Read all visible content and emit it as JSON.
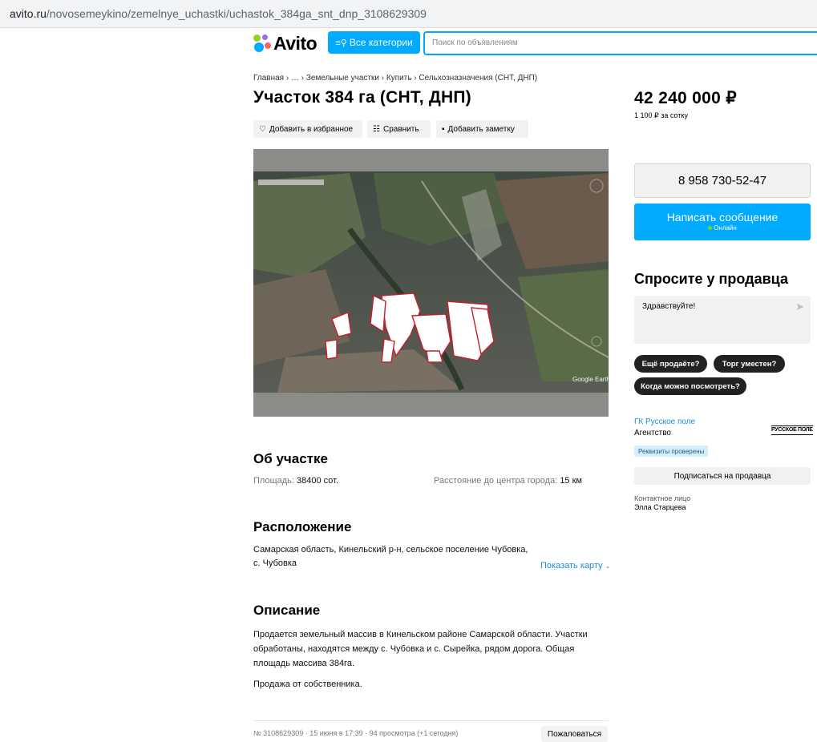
{
  "browser": {
    "url_domain": "avito.ru",
    "url_path": "/novosemeykino/zemelnye_uchastki/uchastok_384ga_snt_dnp_3108629309"
  },
  "header": {
    "logo": "Avito",
    "categories_button": "Все категории",
    "search_placeholder": "Поиск по объявлениям"
  },
  "breadcrumbs": [
    "Главная",
    "…",
    "Земельные участки",
    "Купить",
    "Сельхозназначения (СНТ, ДНП)"
  ],
  "listing": {
    "title": "Участок 384 га (СНТ, ДНП)",
    "actions": {
      "favorite": "Добавить в избранное",
      "compare": "Сравнить",
      "note": "Добавить заметку"
    },
    "photo_watermark": "Google Earth"
  },
  "about": {
    "heading": "Об участке",
    "area_label": "Площадь:",
    "area_value": "38400 сот.",
    "distance_label": "Расстояние до центра города:",
    "distance_value": "15 км"
  },
  "location": {
    "heading": "Расположение",
    "line1": "Самарская область, Кинельский р-н, сельское поселение Чубовка,",
    "line2": "с. Чубовка",
    "show_map": "Показать карту"
  },
  "description": {
    "heading": "Описание",
    "line1": "Продается земельный массив в Кинельском районе Самарской области. Участки",
    "line2": "обработаны, находятся между с. Чубовка и с. Сырейка, рядом дорога. Общая",
    "line3": "площадь массива 384га.",
    "line4": "Продажа от собственника."
  },
  "footer": {
    "meta": "№ 3108629309 · 15 июня в 17:39 · 94 просмотра (+1 сегодня)",
    "complain": "Пожаловаться"
  },
  "sidebar": {
    "price": "42 240 000 ₽",
    "price_per_unit": "1 100 ₽ за сотку",
    "phone": "8 958 730-52-47",
    "message_button": "Написать сообщение",
    "online": "Онлайн",
    "ask_heading": "Спросите у продавца",
    "ask_text": "Здравствуйте!",
    "quick_questions": [
      "Ещё продаёте?",
      "Торг уместен?",
      "Когда можно посмотреть?"
    ],
    "seller_name": "ГК Русское поле",
    "seller_type": "Агентство",
    "seller_logo": "РУССКОЕ ПОЛЕ",
    "verified": "Реквизиты проверены",
    "subscribe": "Подписаться на продавца",
    "contact_label": "Контактное лицо",
    "contact_name": "Элла Старцева"
  },
  "colors": {
    "accent": "#00aaff",
    "link": "#1a8fd6",
    "button_dark": "#222222",
    "online": "#7ed321"
  }
}
